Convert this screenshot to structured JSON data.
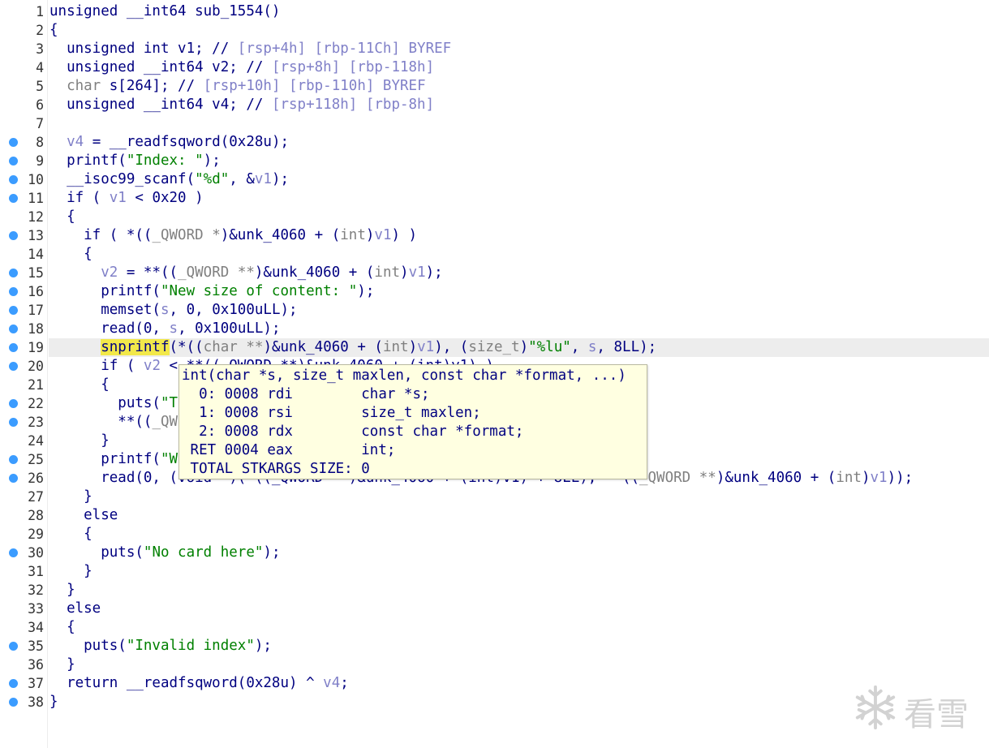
{
  "editor": {
    "lines": [
      {
        "n": "1",
        "bp": false,
        "segs": [
          [
            "unsigned __int64 sub_1554()",
            "kw"
          ]
        ]
      },
      {
        "n": "2",
        "bp": false,
        "segs": [
          [
            "{",
            "kw"
          ]
        ]
      },
      {
        "n": "3",
        "bp": false,
        "segs": [
          [
            "  unsigned int v1; // ",
            "kw"
          ],
          [
            "[rsp+4h] [rbp-11Ch] BYREF",
            "cm"
          ]
        ]
      },
      {
        "n": "4",
        "bp": false,
        "segs": [
          [
            "  unsigned __int64 v2; // ",
            "kw"
          ],
          [
            "[rsp+8h] [rbp-118h]",
            "cm"
          ]
        ]
      },
      {
        "n": "5",
        "bp": false,
        "segs": [
          [
            "  char ",
            "ty"
          ],
          [
            "s[264]; // ",
            "kw"
          ],
          [
            "[rsp+10h] [rbp-110h] BYREF",
            "cm"
          ]
        ]
      },
      {
        "n": "6",
        "bp": false,
        "segs": [
          [
            "  unsigned __int64 v4; // ",
            "kw"
          ],
          [
            "[rsp+118h] [rbp-8h]",
            "cm"
          ]
        ]
      },
      {
        "n": "7",
        "bp": false,
        "segs": []
      },
      {
        "n": "8",
        "bp": true,
        "segs": [
          [
            "  ",
            "kw"
          ],
          [
            "v4",
            "vr"
          ],
          [
            " = __readfsqword(0x28u);",
            "kw"
          ]
        ]
      },
      {
        "n": "9",
        "bp": true,
        "segs": [
          [
            "  printf(",
            "kw"
          ],
          [
            "\"Index: \"",
            "st"
          ],
          [
            ");",
            "kw"
          ]
        ]
      },
      {
        "n": "10",
        "bp": true,
        "segs": [
          [
            "  __isoc99_scanf(",
            "kw"
          ],
          [
            "\"%d\"",
            "st"
          ],
          [
            ", &",
            "kw"
          ],
          [
            "v1",
            "vr"
          ],
          [
            ");",
            "kw"
          ]
        ]
      },
      {
        "n": "11",
        "bp": true,
        "segs": [
          [
            "  if ( ",
            "kw"
          ],
          [
            "v1",
            "vr"
          ],
          [
            " < 0x20 )",
            "kw"
          ]
        ]
      },
      {
        "n": "12",
        "bp": false,
        "segs": [
          [
            "  {",
            "kw"
          ]
        ]
      },
      {
        "n": "13",
        "bp": true,
        "segs": [
          [
            "    if ( *((",
            "kw"
          ],
          [
            "_QWORD *",
            "ty"
          ],
          [
            ")&unk_4060 + (",
            "kw"
          ],
          [
            "int",
            "ty"
          ],
          [
            ")",
            "kw"
          ],
          [
            "v1",
            "vr"
          ],
          [
            ") )",
            "kw"
          ]
        ]
      },
      {
        "n": "14",
        "bp": false,
        "segs": [
          [
            "    {",
            "kw"
          ]
        ]
      },
      {
        "n": "15",
        "bp": true,
        "segs": [
          [
            "      ",
            "kw"
          ],
          [
            "v2",
            "vr"
          ],
          [
            " = **((",
            "kw"
          ],
          [
            "_QWORD **",
            "ty"
          ],
          [
            ")&unk_4060 + (",
            "kw"
          ],
          [
            "int",
            "ty"
          ],
          [
            ")",
            "kw"
          ],
          [
            "v1",
            "vr"
          ],
          [
            ");",
            "kw"
          ]
        ]
      },
      {
        "n": "16",
        "bp": true,
        "segs": [
          [
            "      printf(",
            "kw"
          ],
          [
            "\"New size of content: \"",
            "st"
          ],
          [
            ");",
            "kw"
          ]
        ]
      },
      {
        "n": "17",
        "bp": true,
        "segs": [
          [
            "      memset(",
            "kw"
          ],
          [
            "s",
            "vr"
          ],
          [
            ", 0, 0x100uLL);",
            "kw"
          ]
        ]
      },
      {
        "n": "18",
        "bp": true,
        "segs": [
          [
            "      read(0, ",
            "kw"
          ],
          [
            "s",
            "vr"
          ],
          [
            ", 0x100uLL);",
            "kw"
          ]
        ]
      },
      {
        "n": "19",
        "bp": true,
        "hl": true,
        "segs": [
          [
            "      ",
            "kw"
          ],
          [
            "snprintf",
            "hlword"
          ],
          [
            "(*((",
            "kw"
          ],
          [
            "char **",
            "ty"
          ],
          [
            ")&unk_4060 + (",
            "kw"
          ],
          [
            "int",
            "ty"
          ],
          [
            ")",
            "kw"
          ],
          [
            "v1",
            "vr"
          ],
          [
            "), (",
            "kw"
          ],
          [
            "size_t",
            "ty"
          ],
          [
            ")",
            "kw"
          ],
          [
            "\"%lu\"",
            "st"
          ],
          [
            ", ",
            "kw"
          ],
          [
            "s",
            "vr"
          ],
          [
            ", 8LL);",
            "kw"
          ]
        ]
      },
      {
        "n": "20",
        "bp": true,
        "segs": [
          [
            "      if ( ",
            "kw"
          ],
          [
            "v2",
            "vr"
          ],
          [
            " < **((_QWORD **)&unk_4060 + (int)v1) )",
            "kw"
          ]
        ]
      },
      {
        "n": "21",
        "bp": false,
        "segs": [
          [
            "      {",
            "kw"
          ]
        ]
      },
      {
        "n": "22",
        "bp": true,
        "segs": [
          [
            "        puts(",
            "kw"
          ],
          [
            "\"T",
            "st"
          ]
        ]
      },
      {
        "n": "23",
        "bp": true,
        "segs": [
          [
            "        **((",
            "kw"
          ],
          [
            "_QW",
            "ty"
          ]
        ]
      },
      {
        "n": "24",
        "bp": false,
        "segs": [
          [
            "      }",
            "kw"
          ]
        ]
      },
      {
        "n": "25",
        "bp": true,
        "segs": [
          [
            "      printf(",
            "kw"
          ],
          [
            "\"W",
            "st"
          ]
        ]
      },
      {
        "n": "26",
        "bp": true,
        "segs": [
          [
            "      read(0, (void *)(*((_QWORD **)&unk_4060 + (int)v1) + 8LL), **((",
            "kw"
          ],
          [
            "_QWORD **",
            "ty"
          ],
          [
            ")&unk_4060 + (",
            "kw"
          ],
          [
            "int",
            "ty"
          ],
          [
            ")",
            "kw"
          ],
          [
            "v1",
            "vr"
          ],
          [
            "));",
            "kw"
          ]
        ]
      },
      {
        "n": "27",
        "bp": false,
        "segs": [
          [
            "    }",
            "kw"
          ]
        ]
      },
      {
        "n": "28",
        "bp": false,
        "segs": [
          [
            "    else",
            "kw"
          ]
        ]
      },
      {
        "n": "29",
        "bp": false,
        "segs": [
          [
            "    {",
            "kw"
          ]
        ]
      },
      {
        "n": "30",
        "bp": true,
        "segs": [
          [
            "      puts(",
            "kw"
          ],
          [
            "\"No card here\"",
            "st"
          ],
          [
            ");",
            "kw"
          ]
        ]
      },
      {
        "n": "31",
        "bp": false,
        "segs": [
          [
            "    }",
            "kw"
          ]
        ]
      },
      {
        "n": "32",
        "bp": false,
        "segs": [
          [
            "  }",
            "kw"
          ]
        ]
      },
      {
        "n": "33",
        "bp": false,
        "segs": [
          [
            "  else",
            "kw"
          ]
        ]
      },
      {
        "n": "34",
        "bp": false,
        "segs": [
          [
            "  {",
            "kw"
          ]
        ]
      },
      {
        "n": "35",
        "bp": true,
        "segs": [
          [
            "    puts(",
            "kw"
          ],
          [
            "\"Invalid index\"",
            "st"
          ],
          [
            ");",
            "kw"
          ]
        ]
      },
      {
        "n": "36",
        "bp": false,
        "segs": [
          [
            "  }",
            "kw"
          ]
        ]
      },
      {
        "n": "37",
        "bp": true,
        "segs": [
          [
            "  return __readfsqword(0x28u) ^ ",
            "kw"
          ],
          [
            "v4",
            "vr"
          ],
          [
            ";",
            "kw"
          ]
        ]
      },
      {
        "n": "38",
        "bp": true,
        "segs": [
          [
            "}",
            "kw"
          ]
        ]
      }
    ]
  },
  "tooltip": {
    "lines": [
      "int(char *s, size_t maxlen, const char *format, ...)",
      "  0: 0008 rdi        char *s;",
      "  1: 0008 rsi        size_t maxlen;",
      "  2: 0008 rdx        const char *format;",
      " RET 0004 eax        int;",
      " TOTAL STKARGS SIZE: 0"
    ]
  },
  "watermark": {
    "icon": "snowflake-icon",
    "text": "看雪"
  }
}
